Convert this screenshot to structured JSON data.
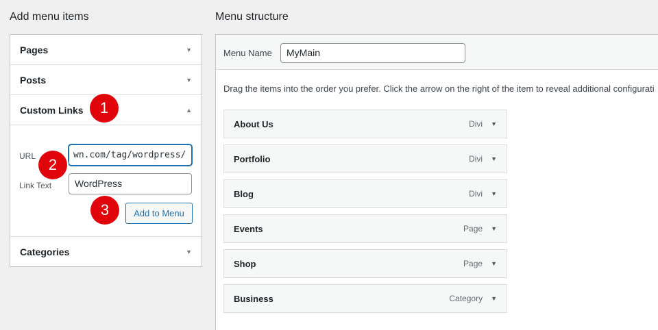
{
  "left_title": "Add menu items",
  "right_title": "Menu structure",
  "accordion": {
    "pages": "Pages",
    "posts": "Posts",
    "custom_links": "Custom Links",
    "categories": "Categories",
    "url_label": "URL",
    "url_value": "wn.com/tag/wordpress/",
    "link_text_label": "Link Text",
    "link_text_value": "WordPress",
    "add_button": "Add to Menu",
    "arrow_down": "▼",
    "arrow_up": "▲"
  },
  "badges": [
    "1",
    "2",
    "3"
  ],
  "menu": {
    "name_label": "Menu Name",
    "name_value": "MyMain",
    "instructions": "Drag the items into the order you prefer. Click the arrow on the right of the item to reveal additional configurati",
    "items": [
      {
        "title": "About Us",
        "type": "Divi"
      },
      {
        "title": "Portfolio",
        "type": "Divi"
      },
      {
        "title": "Blog",
        "type": "Divi"
      },
      {
        "title": "Events",
        "type": "Page"
      },
      {
        "title": "Shop",
        "type": "Page"
      },
      {
        "title": "Business",
        "type": "Category"
      }
    ]
  },
  "colors": {
    "accent": "#2271b1",
    "badge": "#e2040b"
  }
}
